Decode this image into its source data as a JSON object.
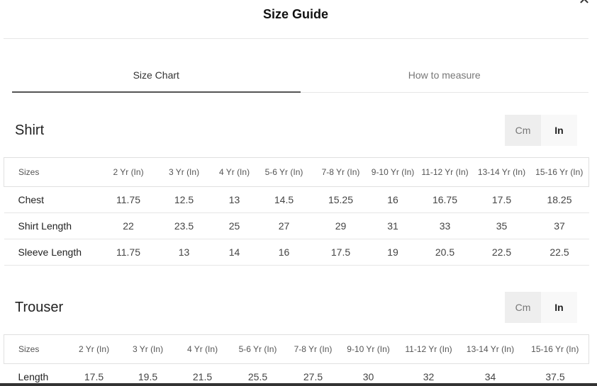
{
  "modal": {
    "title": "Size Guide",
    "close_icon": "close-icon"
  },
  "tabs": [
    {
      "label": "Size Chart",
      "active": true
    },
    {
      "label": "How to measure",
      "active": false
    }
  ],
  "shirt": {
    "title": "Shirt",
    "units": {
      "cm": "Cm",
      "in": "In",
      "selected": "In"
    },
    "headers": [
      "Sizes",
      "2 Yr (In)",
      "3 Yr (In)",
      "4 Yr (In)",
      "5-6 Yr (In)",
      "7-8 Yr (In)",
      "9-10 Yr (In)",
      "11-12 Yr (In)",
      "13-14 Yr (In)",
      "15-16 Yr (In)"
    ],
    "rows": [
      [
        "Chest",
        "11.75",
        "12.5",
        "13",
        "14.5",
        "15.25",
        "16",
        "16.75",
        "17.5",
        "18.25"
      ],
      [
        "Shirt Length",
        "22",
        "23.5",
        "25",
        "27",
        "29",
        "31",
        "33",
        "35",
        "37"
      ],
      [
        "Sleeve Length",
        "11.75",
        "13",
        "14",
        "16",
        "17.5",
        "19",
        "20.5",
        "22.5",
        "22.5"
      ]
    ]
  },
  "trouser": {
    "title": "Trouser",
    "units": {
      "cm": "Cm",
      "in": "In",
      "selected": "In"
    },
    "headers": [
      "Sizes",
      "2 Yr (In)",
      "3 Yr (In)",
      "4 Yr (In)",
      "5-6 Yr (In)",
      "7-8 Yr (In)",
      "9-10 Yr (In)",
      "11-12 Yr (In)",
      "13-14 Yr (In)",
      "15-16 Yr (In)"
    ],
    "rows": [
      [
        "Length",
        "17.5",
        "19.5",
        "21.5",
        "25.5",
        "27.5",
        "30",
        "32",
        "34",
        "37.5"
      ]
    ]
  }
}
